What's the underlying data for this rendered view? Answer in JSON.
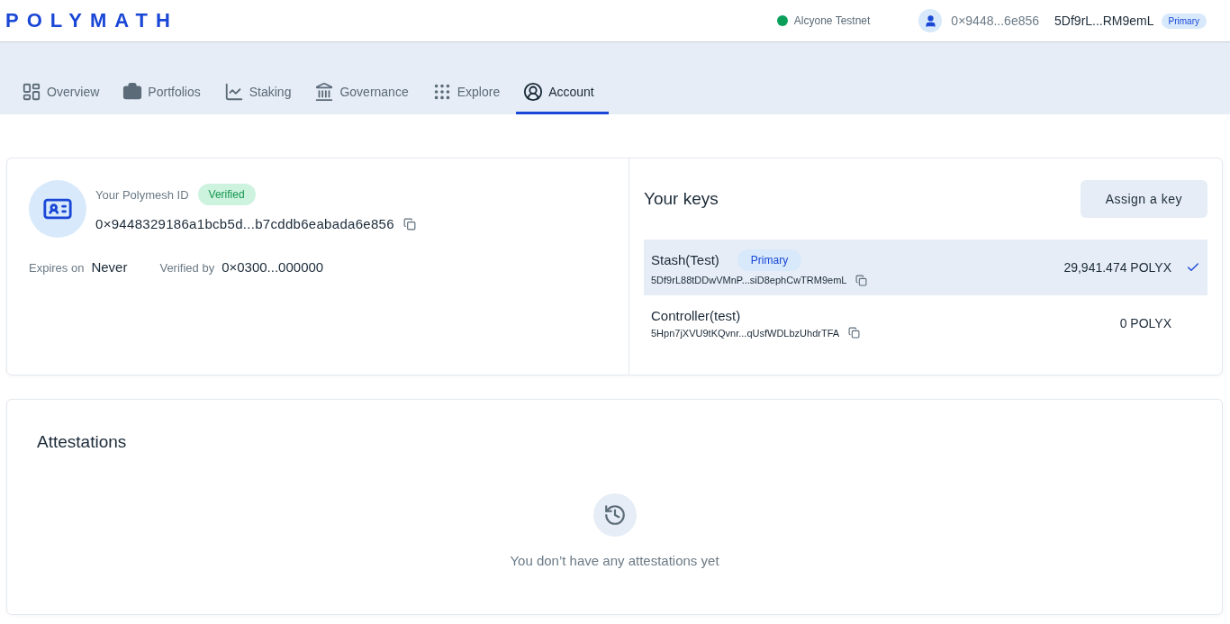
{
  "header": {
    "logo": "POLYMATH",
    "network": {
      "name": "Alcyone Testnet",
      "color": "#0aa05a"
    },
    "account": {
      "did": "0×9448...6e856",
      "key": "5Df9rL...RM9emL",
      "badge": "Primary"
    }
  },
  "tabs": [
    {
      "label": "Overview",
      "kind": "overview",
      "selected": false
    },
    {
      "label": "Portfolios",
      "kind": "portfolios",
      "selected": false
    },
    {
      "label": "Staking",
      "kind": "staking",
      "selected": false
    },
    {
      "label": "Governance",
      "kind": "governance",
      "selected": false
    },
    {
      "label": "Explore",
      "kind": "explore",
      "selected": false
    },
    {
      "label": "Account",
      "kind": "account",
      "selected": true
    }
  ],
  "identity": {
    "label": "Your Polymesh ID",
    "status": "Verified",
    "did": "0×9448329186a1bcb5d...b7cddb6eabada6e856",
    "expires_label": "Expires on",
    "expires": "Never",
    "verified_by_label": "Verified by",
    "verified_by": "0×0300...000000"
  },
  "keys": {
    "title": "Your keys",
    "button": "Assign a key",
    "items": [
      {
        "name": "Stash(Test)",
        "badge": "Primary",
        "address": "5Df9rL88tDDwVMnP...siD8ephCwTRM9emL",
        "balance": "29,941.474 POLYX",
        "selected": true
      },
      {
        "name": "Controller(test)",
        "address": "5Hpn7jXVU9tKQvnr...qUsfWDLbzUhdrTFA",
        "balance": "0 POLYX",
        "selected": false
      }
    ]
  },
  "attestations": {
    "title": "Attestations",
    "empty": "You don’t have any attestations yet"
  }
}
